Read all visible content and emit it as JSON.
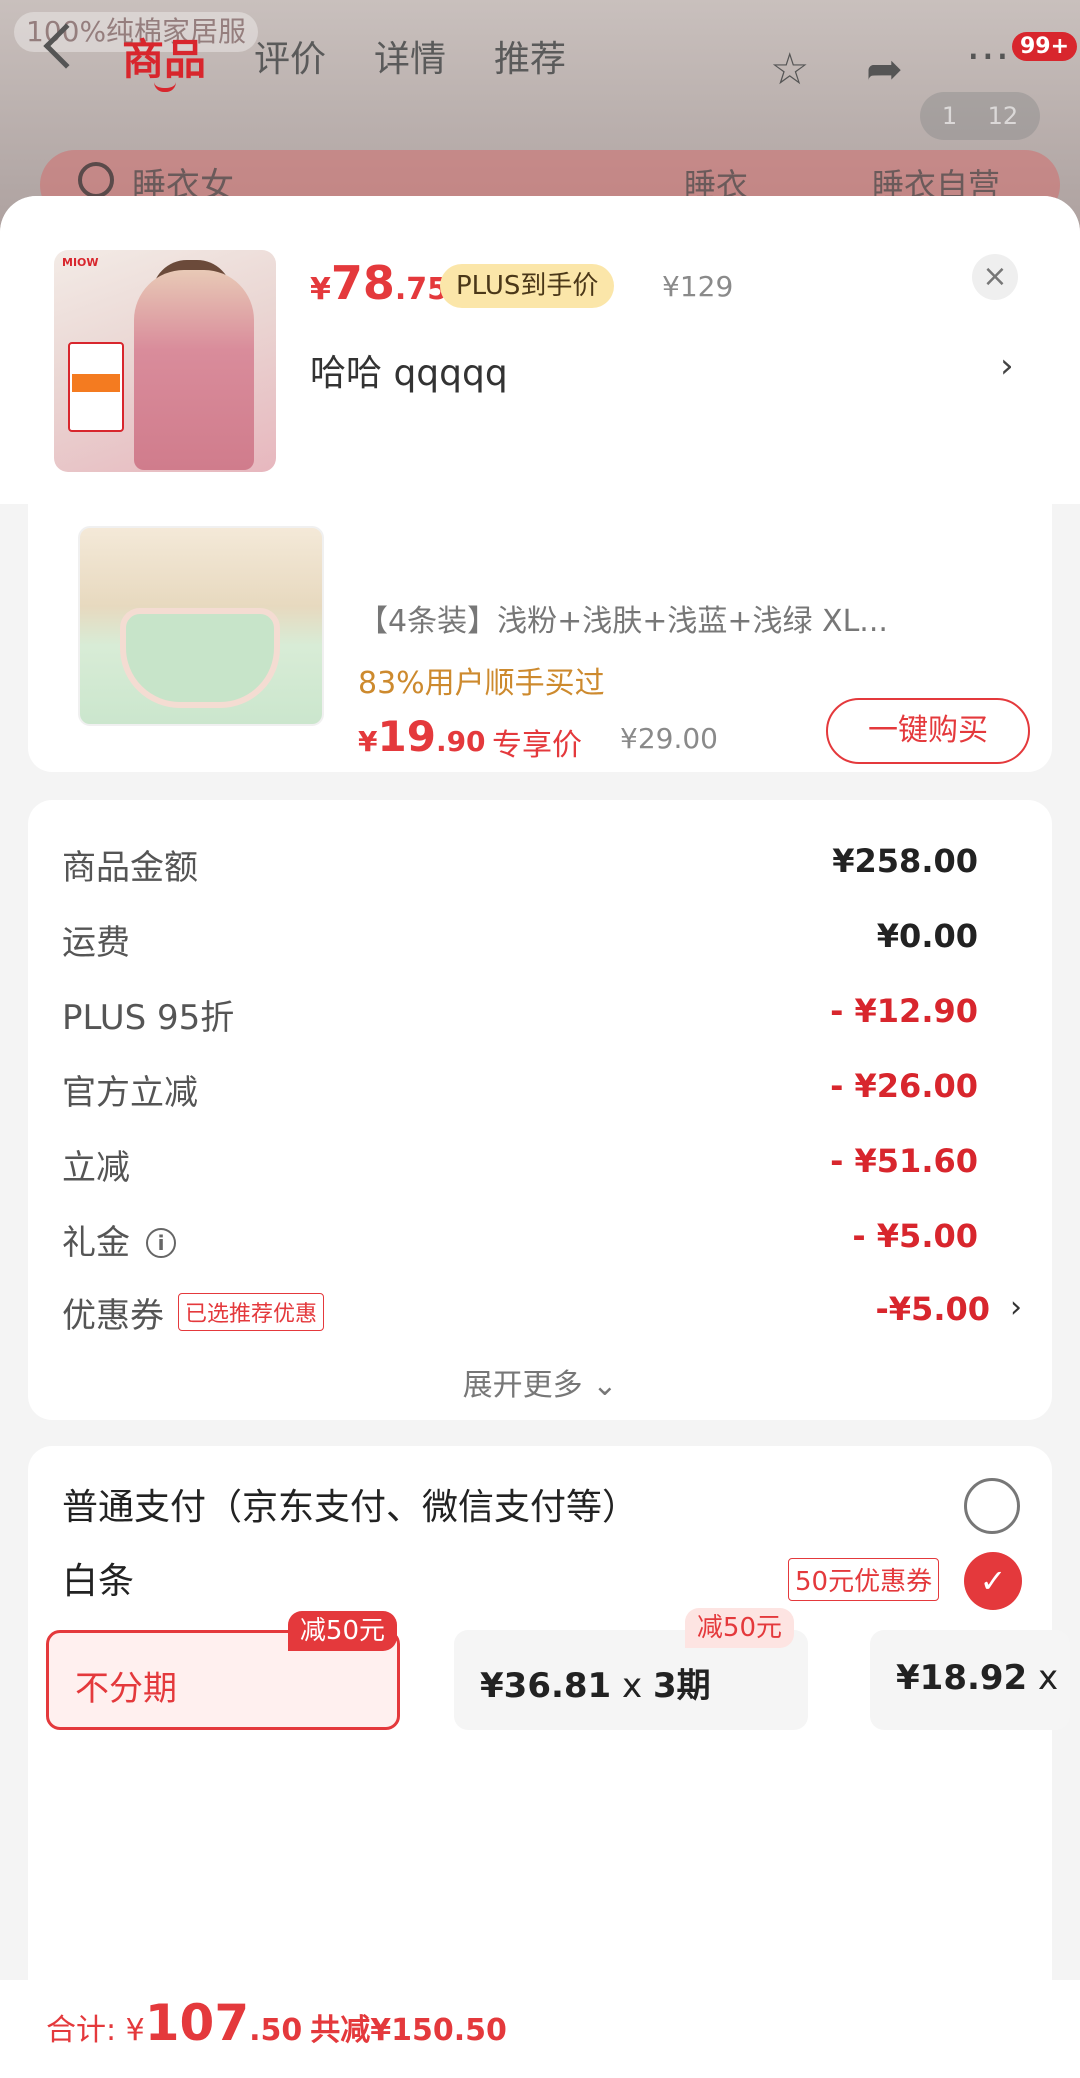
{
  "background": {
    "promo_text": "100%纯棉家居服",
    "tabs": [
      "商品",
      "评价",
      "详情",
      "推荐"
    ],
    "cart_badge": "99+",
    "pager": {
      "current": "1",
      "total": "12"
    },
    "search_text": "睡衣女",
    "search_chips": [
      "睡衣",
      "睡衣自营"
    ],
    "icons": [
      "back-icon",
      "star-icon",
      "share-icon",
      "more-icon"
    ]
  },
  "header": {
    "price": {
      "currency": "¥",
      "integer": "78",
      "decimal": ".75"
    },
    "plus_tag": "PLUS到手价",
    "original_price": "¥129",
    "sku_label": "哈哈  qqqqq",
    "close_symbol": "×",
    "arrow": "›",
    "thumb_logo": "MIOW"
  },
  "recommend": {
    "name": "【4条装】浅粉+浅肤+浅蓝+浅绿   XL...",
    "users": "83%用户顺手买过",
    "price": {
      "currency": "¥",
      "integer": "19",
      "decimal": ".90"
    },
    "price_label": "专享价",
    "original_price": "¥29.00",
    "buy_button": "一键购买"
  },
  "amounts": {
    "rows": [
      {
        "label": "商品金额",
        "value": "¥258.00",
        "red": false
      },
      {
        "label": "运费",
        "value": "¥0.00",
        "red": false
      },
      {
        "label": "PLUS 95折",
        "value": "- ¥12.90",
        "red": true
      },
      {
        "label": "官方立减",
        "value": "- ¥26.00",
        "red": true
      },
      {
        "label": "立减",
        "value": "- ¥51.60",
        "red": true
      },
      {
        "label": "礼金",
        "value": "- ¥5.00",
        "red": true
      },
      {
        "label": "优惠券",
        "value": "-¥5.00",
        "red": true
      }
    ],
    "info_symbol": "i",
    "coupon_tag": "已选推荐优惠",
    "coupon_arrow": "›",
    "expand_more": "展开更多 ⌄"
  },
  "payment": {
    "normal_label": "普通支付（京东支付、微信支付等）",
    "baitiao_label": "白条",
    "baitiao_coupon": "50元优惠券",
    "checkmark": "✓",
    "plans": [
      {
        "text": "不分期",
        "badge": "减50元"
      },
      {
        "text": "¥36.81",
        "times": " x ",
        "period": "3期",
        "badge": "减50元"
      },
      {
        "text": "¥18.92",
        "times": " x",
        "period": "",
        "badge": ""
      }
    ]
  },
  "footer": {
    "total_label": "合计: ",
    "currency": "¥",
    "integer": "107",
    "decimal": ".50",
    "saved": "共减¥150.50"
  },
  "colors": {
    "accent": "#e4393c",
    "plus_gold": "#fbe6a9",
    "users_orange": "#cd8a2e"
  }
}
